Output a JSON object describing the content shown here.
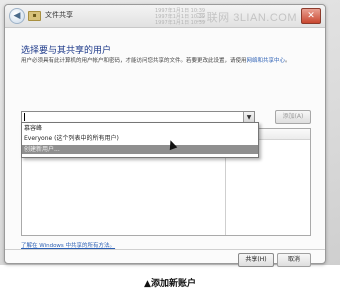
{
  "titlebar": {
    "back_icon": "back-arrow-icon",
    "folder_icon": "folder-icon",
    "title": "文件共享",
    "background_text": [
      "1997年1月1日 10:39",
      "1997年1月1日 10:39",
      "1997年1月1日 10:39"
    ],
    "watermark": "三联网 3LIAN.COM",
    "close_icon": "close-icon"
  },
  "main": {
    "heading": "选择要与其共享的用户",
    "description": "用户必须具有此计算机的用户帐户和密码，才能访问您共享的文件。若要更改此设置，请使用",
    "description_link": "网络和共享中心",
    "description_end": "。",
    "combo_value": "",
    "add_button": "添加(A)"
  },
  "dropdown": {
    "items": [
      "慕容峰",
      "Everyone (这个列表中的所有用户)",
      "创建新用户..."
    ],
    "selected_index": 2
  },
  "footer": {
    "help_link": "了解在 Windows 中共享的所有方法。",
    "share_button": "共享(H)",
    "cancel_button": "取消"
  },
  "caption": "▲添加新账户"
}
